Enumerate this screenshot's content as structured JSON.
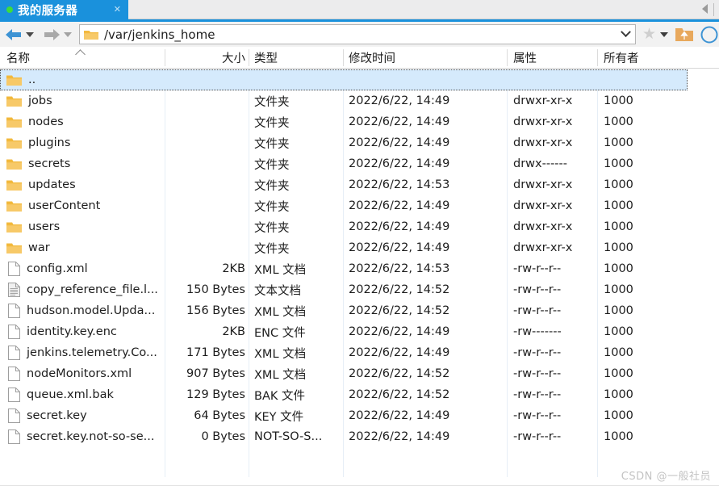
{
  "window": {
    "tab": {
      "title": "我的服务器",
      "close_label": "✕",
      "status_color": "#3ddc3d"
    },
    "accent_color": "#1a91dc"
  },
  "toolbar": {
    "back_label": "←",
    "forward_label": "→",
    "address_value": "/var/jenkins_home",
    "address_placeholder": "/var/jenkins_home",
    "star_label": "★",
    "icons": [
      "back-arrow-icon",
      "forward-arrow-icon",
      "folder-icon",
      "chevron-down-icon",
      "star-icon",
      "parent-folder-icon",
      "refresh-icon"
    ]
  },
  "columns": [
    {
      "key": "name",
      "label": "名称",
      "sort": "asc"
    },
    {
      "key": "size",
      "label": "大小"
    },
    {
      "key": "type",
      "label": "类型"
    },
    {
      "key": "time",
      "label": "修改时间"
    },
    {
      "key": "attr",
      "label": "属性"
    },
    {
      "key": "owner",
      "label": "所有者"
    }
  ],
  "rows": [
    {
      "name": "..",
      "icon": "folder",
      "size": "",
      "type": "",
      "time": "",
      "attr": "",
      "owner": "",
      "selected": true
    },
    {
      "name": "jobs",
      "icon": "folder",
      "size": "",
      "type": "文件夹",
      "time": "2022/6/22, 14:49",
      "attr": "drwxr-xr-x",
      "owner": "1000"
    },
    {
      "name": "nodes",
      "icon": "folder",
      "size": "",
      "type": "文件夹",
      "time": "2022/6/22, 14:49",
      "attr": "drwxr-xr-x",
      "owner": "1000"
    },
    {
      "name": "plugins",
      "icon": "folder",
      "size": "",
      "type": "文件夹",
      "time": "2022/6/22, 14:49",
      "attr": "drwxr-xr-x",
      "owner": "1000"
    },
    {
      "name": "secrets",
      "icon": "folder",
      "size": "",
      "type": "文件夹",
      "time": "2022/6/22, 14:49",
      "attr": "drwx------",
      "owner": "1000"
    },
    {
      "name": "updates",
      "icon": "folder",
      "size": "",
      "type": "文件夹",
      "time": "2022/6/22, 14:53",
      "attr": "drwxr-xr-x",
      "owner": "1000"
    },
    {
      "name": "userContent",
      "icon": "folder",
      "size": "",
      "type": "文件夹",
      "time": "2022/6/22, 14:49",
      "attr": "drwxr-xr-x",
      "owner": "1000"
    },
    {
      "name": "users",
      "icon": "folder",
      "size": "",
      "type": "文件夹",
      "time": "2022/6/22, 14:49",
      "attr": "drwxr-xr-x",
      "owner": "1000"
    },
    {
      "name": "war",
      "icon": "folder",
      "size": "",
      "type": "文件夹",
      "time": "2022/6/22, 14:49",
      "attr": "drwxr-xr-x",
      "owner": "1000"
    },
    {
      "name": "config.xml",
      "icon": "file",
      "size": "2KB",
      "type": "XML 文档",
      "time": "2022/6/22, 14:53",
      "attr": "-rw-r--r--",
      "owner": "1000"
    },
    {
      "name": "copy_reference_file.l...",
      "icon": "text",
      "size": "150 Bytes",
      "type": "文本文档",
      "time": "2022/6/22, 14:52",
      "attr": "-rw-r--r--",
      "owner": "1000"
    },
    {
      "name": "hudson.model.Upda...",
      "icon": "file",
      "size": "156 Bytes",
      "type": "XML 文档",
      "time": "2022/6/22, 14:52",
      "attr": "-rw-r--r--",
      "owner": "1000"
    },
    {
      "name": "identity.key.enc",
      "icon": "file",
      "size": "2KB",
      "type": "ENC 文件",
      "time": "2022/6/22, 14:49",
      "attr": "-rw-------",
      "owner": "1000"
    },
    {
      "name": "jenkins.telemetry.Co...",
      "icon": "file",
      "size": "171 Bytes",
      "type": "XML 文档",
      "time": "2022/6/22, 14:49",
      "attr": "-rw-r--r--",
      "owner": "1000"
    },
    {
      "name": "nodeMonitors.xml",
      "icon": "file",
      "size": "907 Bytes",
      "type": "XML 文档",
      "time": "2022/6/22, 14:52",
      "attr": "-rw-r--r--",
      "owner": "1000"
    },
    {
      "name": "queue.xml.bak",
      "icon": "file",
      "size": "129 Bytes",
      "type": "BAK 文件",
      "time": "2022/6/22, 14:52",
      "attr": "-rw-r--r--",
      "owner": "1000"
    },
    {
      "name": "secret.key",
      "icon": "file",
      "size": "64 Bytes",
      "type": "KEY 文件",
      "time": "2022/6/22, 14:49",
      "attr": "-rw-r--r--",
      "owner": "1000"
    },
    {
      "name": "secret.key.not-so-se...",
      "icon": "file",
      "size": "0 Bytes",
      "type": "NOT-SO-S...",
      "time": "2022/6/22, 14:49",
      "attr": "-rw-r--r--",
      "owner": "1000"
    }
  ],
  "watermark": "CSDN @一般社员"
}
